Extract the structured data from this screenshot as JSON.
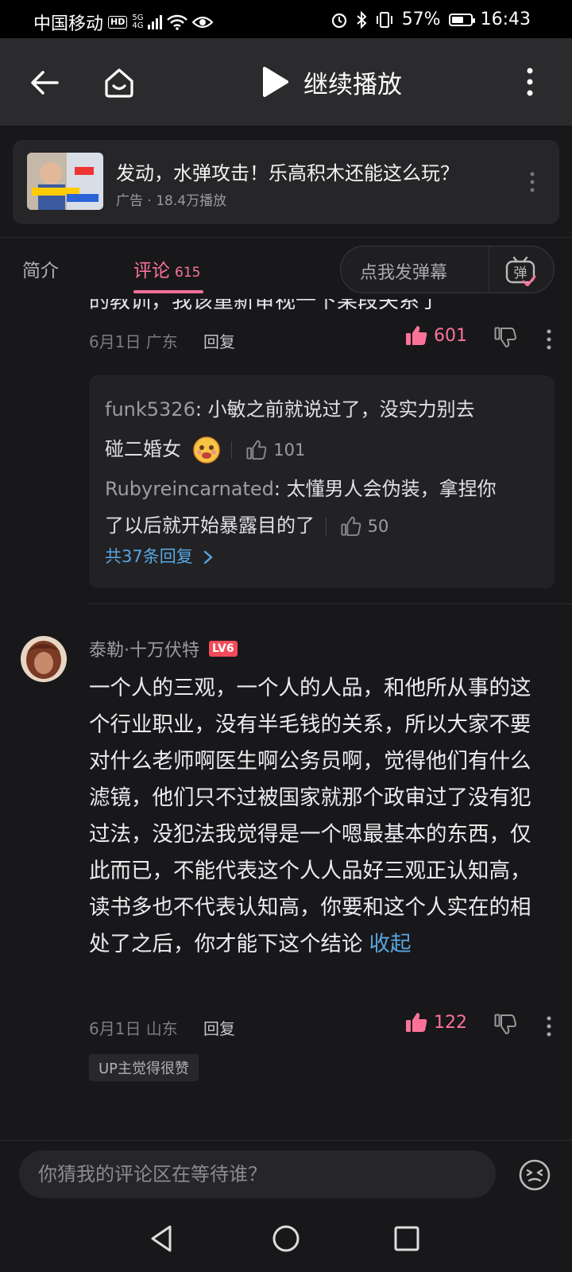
{
  "status_bar": {
    "carrier": "中国移动",
    "hd": "HD",
    "network_top": "5G",
    "network_bottom": "4G",
    "battery": "57%",
    "time": "16:43"
  },
  "header": {
    "play_label": "继续播放"
  },
  "ad": {
    "title": "发动，水弹攻击！乐高积木还能这么玩？",
    "meta": "广告 · 18.4万播放"
  },
  "tabs": {
    "intro": "简介",
    "comments": "评论",
    "comments_count": "615",
    "danmu_placeholder": "点我发弹幕",
    "danmu_icon_text": "弹"
  },
  "comment1": {
    "cut_text": "的教训，我该重新审视一下某段关系了",
    "date": "6月1日 广东",
    "reply": "回复",
    "likes": "601",
    "replies": [
      {
        "user": "funk5326",
        "text1": ": 小敏之前就说过了，没实力别去",
        "text2": "碰二婚女",
        "likes": "101"
      },
      {
        "user": "Rubyreincarnated",
        "text1": ": 太懂男人会伪装，拿捏你",
        "text2": "了以后就开始暴露目的了",
        "likes": "50"
      }
    ],
    "more_replies": "共37条回复"
  },
  "comment2": {
    "username": "泰勒·十万伏特",
    "level": "LV6",
    "text": "一个人的三观，一个人的人品，和他所从事的这个行业职业，没有半毛钱的关系，所以大家不要对什么老师啊医生啊公务员啊，觉得他们有什么滤镜，他们只不过被国家就那个政审过了没有犯过法，没犯法我觉得是一个嗯最基本的东西，仅此而已，不能代表这个人人品好三观正认知高，读书多也不代表认知高，你要和这个人实在的相处了之后，你才能下这个结论",
    "collapse": "收起",
    "date": "6月1日 山东",
    "reply": "回复",
    "likes": "122",
    "up_badge": "UP主觉得很赞"
  },
  "input": {
    "placeholder": "你猜我的评论区在等待谁？"
  },
  "colors": {
    "accent": "#fb7299",
    "link": "#58a6e0",
    "background": "#18181a"
  }
}
